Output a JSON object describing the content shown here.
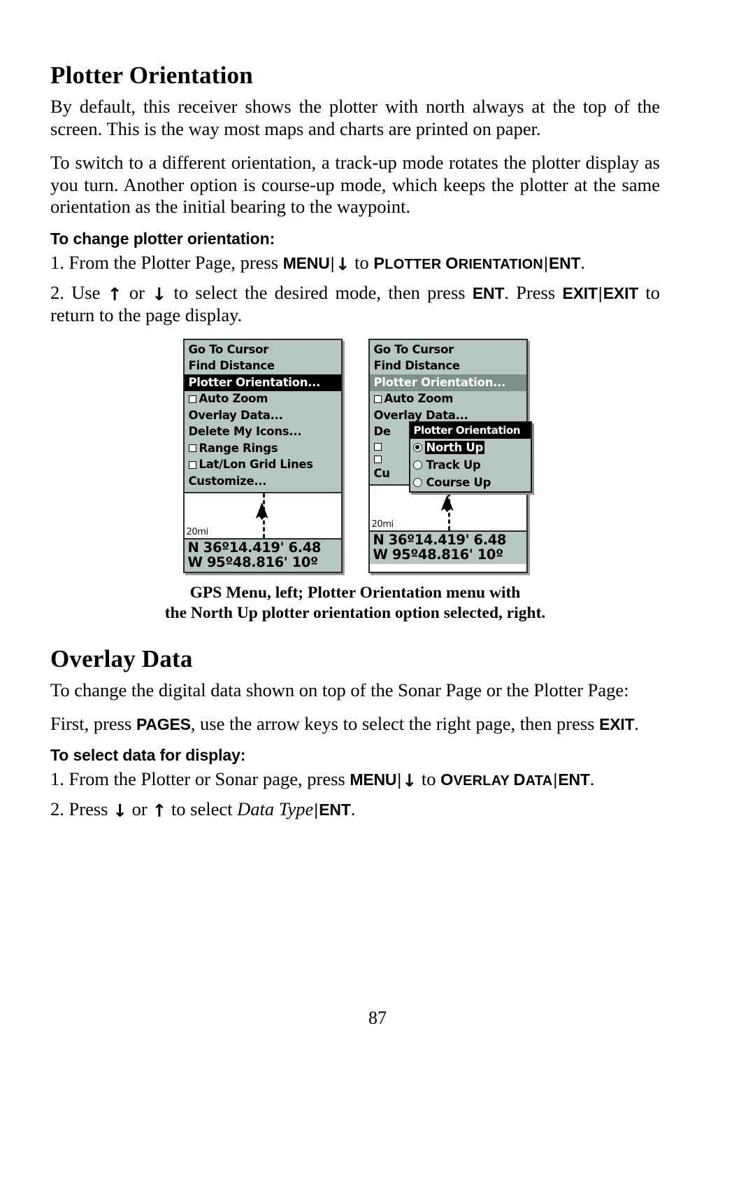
{
  "document": {
    "page_number": "87"
  },
  "sections": [
    {
      "title": "Plotter Orientation",
      "paragraphs": [
        "By default, this receiver shows the plotter with north always at the top of the screen. This is the way most maps and charts are printed on paper.",
        "To switch to a different orientation, a track-up mode rotates the plotter display as you turn. Another option is course-up mode, which keeps the plotter at the same orientation as the initial bearing to the waypoint."
      ],
      "subhead": "To change plotter orientation:"
    },
    {
      "title": "Overlay Data",
      "paragraphs": [
        "To change the digital data shown on top of the Sonar Page or the Plotter Page:",
        "First, press PAGES, use the arrow keys to select the right page, then press EXIT."
      ],
      "subhead": "To select data for display:"
    }
  ],
  "steps_plotter": {
    "step1": {
      "prefix": "1. From the Plotter Page, press ",
      "key1": "MENU",
      "sep1": "|",
      "arrow": "↓",
      "mid": " to ",
      "target_caps": "PLOTTER ORIENTATION",
      "sep2": "|",
      "key2": "ENT",
      "suffix": "."
    },
    "step2": {
      "part1": "2. Use ",
      "up": "↑",
      "or": " or ",
      "down": "↓",
      "part2": " to select the desired mode, then press ",
      "key_ent": "ENT",
      "part3": ". Press ",
      "key_exit_a": "EXIT",
      "sep": "|",
      "key_exit_b": "EXIT",
      "part4": " to return to the page display."
    }
  },
  "steps_overlay": {
    "step1": {
      "prefix": "1. From the Plotter or Sonar page, press ",
      "key1": "MENU",
      "sep1": "|",
      "arrow": "↓",
      "mid": " to ",
      "target_caps": "OVERLAY DATA",
      "sep2": "|",
      "key2": "ENT",
      "suffix": "."
    },
    "step2": {
      "part1": "2. Press ",
      "down": "↓",
      "or": " or ",
      "up": "↑",
      "part2": " to select ",
      "italic": "Data Type",
      "sep": "|",
      "key_ent": "ENT",
      "suffix": "."
    }
  },
  "figure": {
    "caption_line1": "GPS Menu, left; Plotter Orientation menu with",
    "caption_line2": "the North Up plotter orientation option selected, right.",
    "left_device": {
      "menu_items": [
        {
          "label": "Go To Cursor",
          "checkbox": false,
          "state": "normal"
        },
        {
          "label": "Find Distance",
          "checkbox": false,
          "state": "normal"
        },
        {
          "label": "Plotter Orientation...",
          "checkbox": false,
          "state": "highlight-black"
        },
        {
          "label": "Auto Zoom",
          "checkbox": true,
          "state": "normal"
        },
        {
          "label": "Overlay Data...",
          "checkbox": false,
          "state": "normal"
        },
        {
          "label": "Delete My Icons...",
          "checkbox": false,
          "state": "normal"
        },
        {
          "label": "Range Rings",
          "checkbox": true,
          "state": "normal"
        },
        {
          "label": "Lat/Lon Grid Lines",
          "checkbox": true,
          "state": "normal"
        },
        {
          "label": "Customize...",
          "checkbox": false,
          "state": "normal"
        }
      ],
      "scale": "20mi",
      "coord_lat": "N  36º14.419' 6.48",
      "coord_lon": "W  95º48.816' 10º"
    },
    "right_device": {
      "menu_items": [
        {
          "label": "Go To Cursor",
          "checkbox": false,
          "state": "normal"
        },
        {
          "label": "Find Distance",
          "checkbox": false,
          "state": "normal"
        },
        {
          "label": "Plotter Orientation...",
          "checkbox": false,
          "state": "highlight-gray"
        },
        {
          "label": "Auto Zoom",
          "checkbox": true,
          "state": "normal"
        },
        {
          "label": "Overlay Data...",
          "checkbox": false,
          "state": "normal"
        },
        {
          "label": "De",
          "checkbox": false,
          "state": "normal"
        },
        {
          "label": "",
          "checkbox": true,
          "state": "normal"
        },
        {
          "label": "",
          "checkbox": true,
          "state": "normal"
        },
        {
          "label": "Cu",
          "checkbox": false,
          "state": "normal"
        }
      ],
      "submenu": {
        "title": "Plotter Orientation",
        "options": [
          {
            "label": "North Up",
            "selected": true
          },
          {
            "label": "Track Up",
            "selected": false
          },
          {
            "label": "Course Up",
            "selected": false
          }
        ]
      },
      "scale": "20mi",
      "coord_lat": "N  36º14.419' 6.48",
      "coord_lon": "W  95º48.816' 10º"
    }
  },
  "colors": {
    "menu_bg": "#b6c6c2",
    "highlight_black": "#000000",
    "highlight_gray": "#7f908c",
    "border": "#2b2b2b"
  }
}
